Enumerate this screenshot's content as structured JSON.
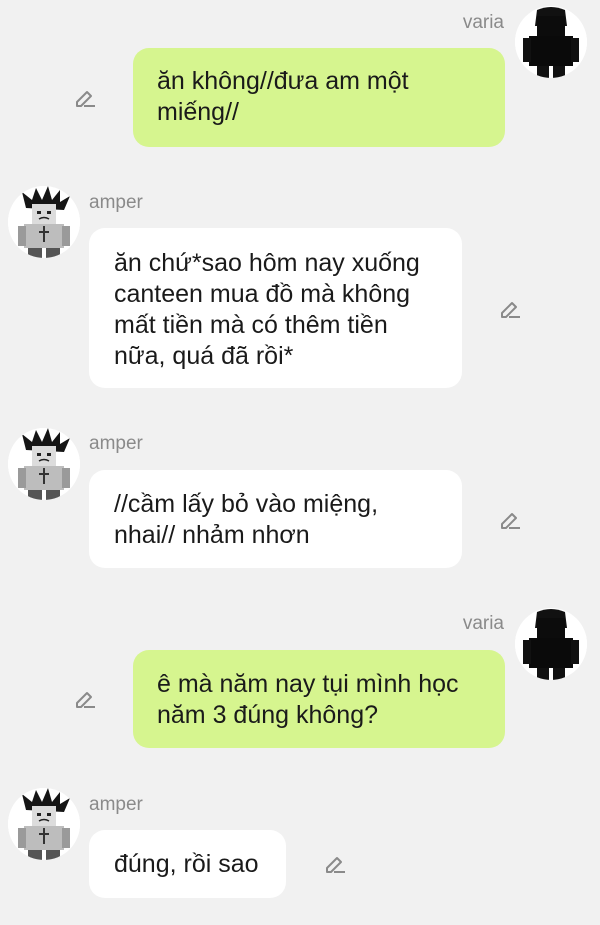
{
  "messages": [
    {
      "sender": "varia",
      "side": "right",
      "text": "ăn không//đưa am một miếng//",
      "avatar_icon": "varia-avatar"
    },
    {
      "sender": "amper",
      "side": "left",
      "text": "ăn chứ*sao hôm nay xuống canteen mua đồ mà không mất tiền mà có thêm tiền nữa, quá đã rồi*",
      "avatar_icon": "amper-avatar"
    },
    {
      "sender": "amper",
      "side": "left",
      "text": "//cầm lấy bỏ vào miệng, nhai// nhảm nhơn",
      "avatar_icon": "amper-avatar"
    },
    {
      "sender": "varia",
      "side": "right",
      "text": "ê mà năm nay tụi mình học năm 3 đúng không?",
      "avatar_icon": "varia-avatar"
    },
    {
      "sender": "amper",
      "side": "left",
      "text": "đúng, rồi sao",
      "avatar_icon": "amper-avatar"
    }
  ],
  "colors": {
    "background": "#f1f1f1",
    "own_bubble": "#d6f58f",
    "other_bubble": "#ffffff",
    "name_text": "#8a8a8a",
    "edit_icon": "#8a8a8a"
  },
  "icons": {
    "edit": "pencil-edit-icon"
  }
}
